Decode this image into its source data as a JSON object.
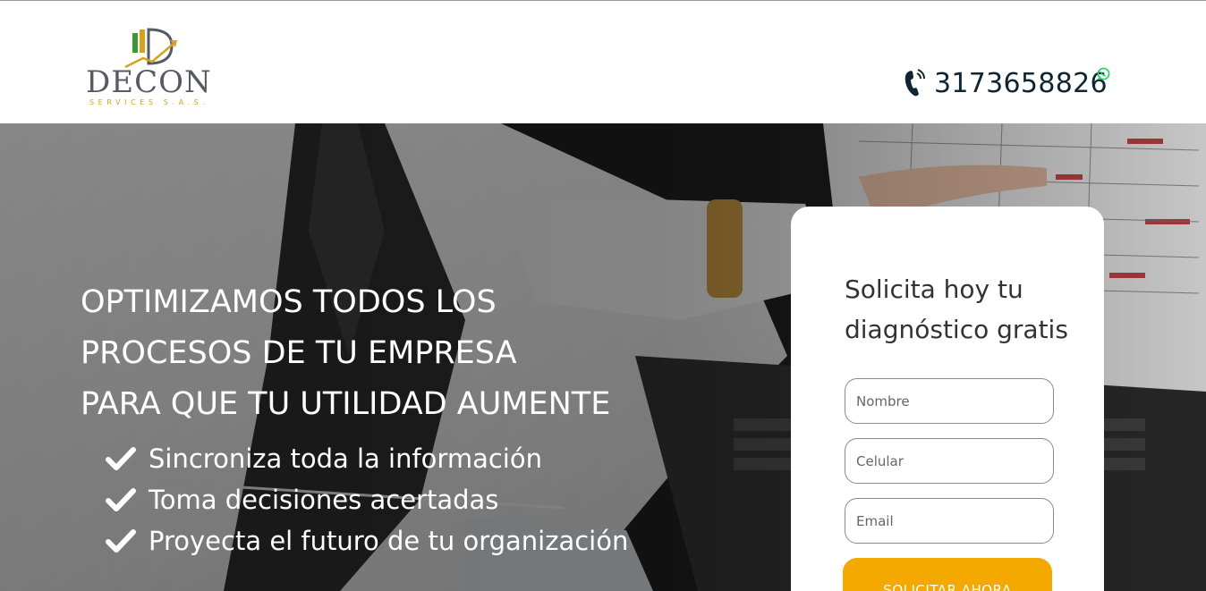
{
  "header": {
    "logo": {
      "word": "DECON",
      "subtitle": "SERVICES S.A.S."
    },
    "phone": {
      "number": "3173658826"
    }
  },
  "hero": {
    "headline": [
      "OPTIMIZAMOS TODOS LOS",
      "PROCESOS DE TU EMPRESA",
      "PARA QUE TU UTILIDAD AUMENTE"
    ],
    "benefits": [
      "Sincroniza toda la información",
      "Toma decisiones acertadas",
      "Proyecta el futuro de tu organización"
    ]
  },
  "form": {
    "title": "Solicita hoy tu diagnóstico gratis",
    "fields": {
      "name_placeholder": "Nombre",
      "phone_placeholder": "Celular",
      "email_placeholder": "Email"
    },
    "submit_label": "SOLICITAR AHORA"
  },
  "colors": {
    "accent": "#f4a900",
    "logo_gold": "#d9a21b",
    "logo_green": "#3a9a3a",
    "logo_gray": "#555a66",
    "phone_text": "#0f2533",
    "whatsapp": "#25d366"
  }
}
